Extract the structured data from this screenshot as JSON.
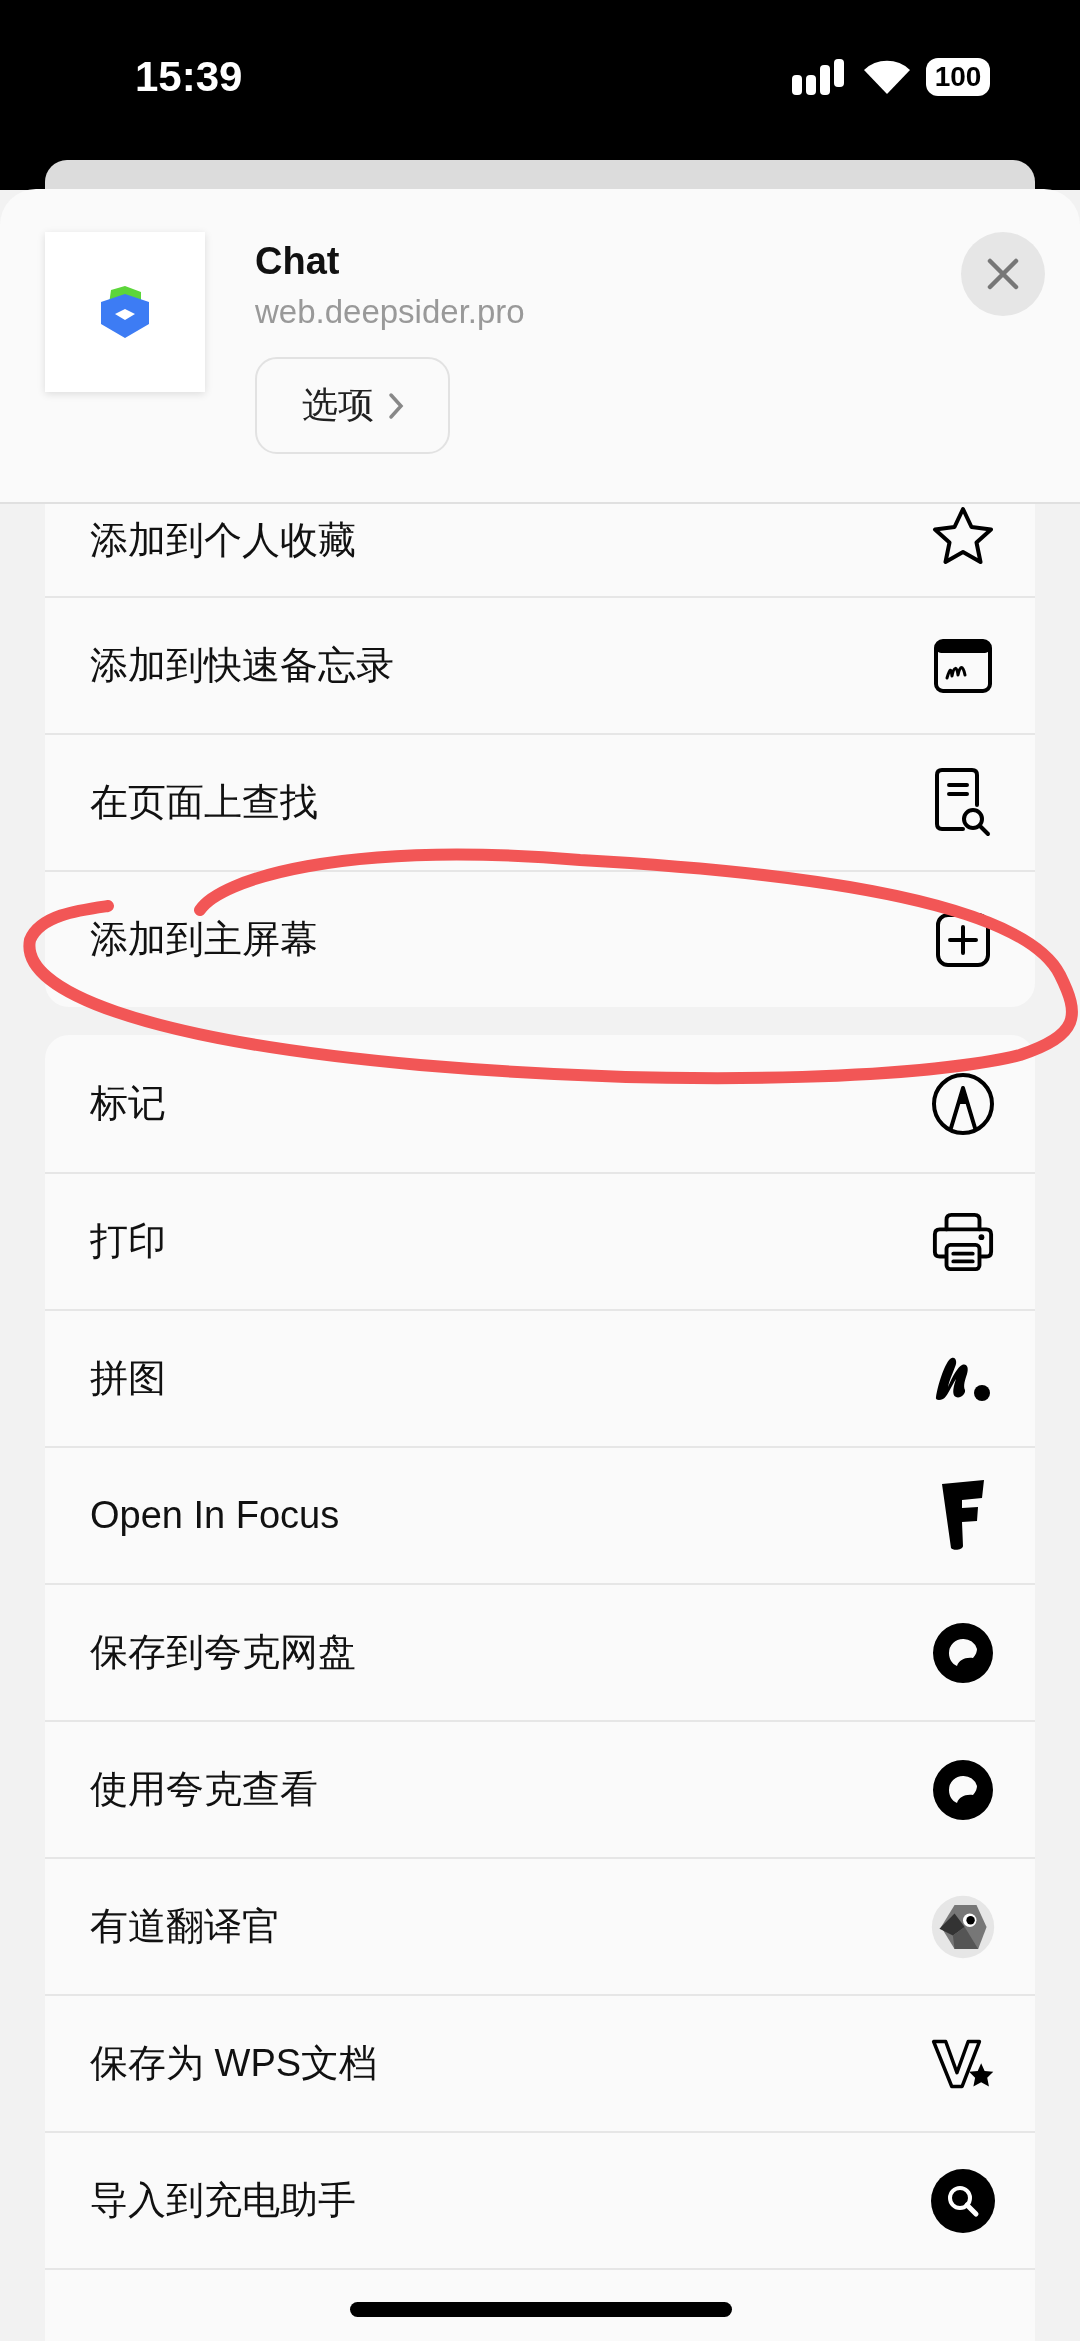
{
  "status_bar": {
    "time": "15:39",
    "battery": "100"
  },
  "sheet": {
    "title": "Chat",
    "url": "web.deepsider.pro",
    "options_button": "选项"
  },
  "groups": [
    {
      "items": [
        {
          "label": "添加到个人收藏"
        },
        {
          "label": "添加到快速备忘录"
        },
        {
          "label": "在页面上查找"
        },
        {
          "label": "添加到主屏幕"
        }
      ]
    },
    {
      "items": [
        {
          "label": "标记"
        },
        {
          "label": "打印"
        },
        {
          "label": "拼图"
        },
        {
          "label": "Open In Focus"
        },
        {
          "label": "保存到夸克网盘"
        },
        {
          "label": "使用夸克查看"
        },
        {
          "label": "有道翻译官"
        },
        {
          "label": "保存为 WPS文档"
        },
        {
          "label": "导入到充电助手"
        }
      ]
    }
  ]
}
